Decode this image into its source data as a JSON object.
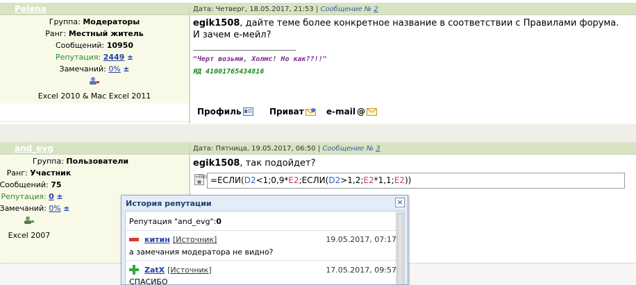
{
  "post1": {
    "nick": "Pelena",
    "header_date": "Дата: Четверг, 18.05.2017, 21:53 |",
    "header_msg_label": "Сообщение №",
    "header_msg_num": "2",
    "group_label": "Группа:",
    "group_value": "Модераторы",
    "rank_label": "Ранг:",
    "rank_value": "Местный житель",
    "posts_label": "Сообщений:",
    "posts_value": "10950",
    "rep_label": "Репутация:",
    "rep_value": "2449",
    "rep_pm": "±",
    "warn_label": "Замечаний:",
    "warn_value": "0%",
    "warn_pm": "±",
    "software": "Excel 2010 & Mac Excel 2011",
    "body_nick": "egik1508",
    "body_text_1": ", дайте теме более конкретное название в соответствии с Правилами форума.",
    "body_text_2": "И зачем е-мейл?",
    "signature_1": "\"Черт возьми, Холмс! Но как??!!\"",
    "signature_2": "ЯД 41001765434816",
    "actions": {
      "profile": "Профиль",
      "private": "Приват",
      "email": "e-mail"
    }
  },
  "post2": {
    "nick": "and_evg",
    "header_date": "Дата: Пятница, 19.05.2017, 06:50 |",
    "header_msg_label": "Сообщение №",
    "header_msg_num": "3",
    "group_label": "Группа:",
    "group_value": "Пользователи",
    "rank_label": "Ранг:",
    "rank_value": "Участник",
    "posts_label": "Сообщений:",
    "posts_value": "75",
    "rep_label": "Репутация:",
    "rep_value": "0",
    "rep_pm": "±",
    "warn_label": "Замечаний:",
    "warn_value": "0%",
    "warn_pm": "±",
    "software": "Excel 2007",
    "body_nick": "egik1508",
    "body_text": ", так подойдет?",
    "formula": {
      "p1": "=ЕСЛИ(",
      "r1": "D2",
      "p2": "<1;0,9*",
      "r2": "E2",
      "p3": ";ЕСЛИ(",
      "r3": "D2",
      "p4": ">1,2;",
      "r4": "E2",
      "p5": "*1,1;",
      "r5": "E2",
      "p6": "))"
    }
  },
  "popup": {
    "title": "История репутации",
    "close": "×",
    "summary_prefix": "Репутация \"and_evg\":",
    "summary_value": "0",
    "entries": [
      {
        "who": "китин",
        "source": "[Источник]",
        "date": "19.05.2017, 07:17",
        "text": "а замечания модератора не видно?",
        "type": "minus"
      },
      {
        "who": "ZatX",
        "source": "[Источник]",
        "date": "17.05.2017, 09:57",
        "text": "СПАСИБО",
        "type": "plus"
      }
    ]
  },
  "colors": {
    "header_bg": "#d8e3c3",
    "left_panel_bg": "#f9f9e8",
    "link": "#2140a0",
    "reputation_label": "#2b8a2b",
    "popup_bg": "#e4ecf7"
  }
}
